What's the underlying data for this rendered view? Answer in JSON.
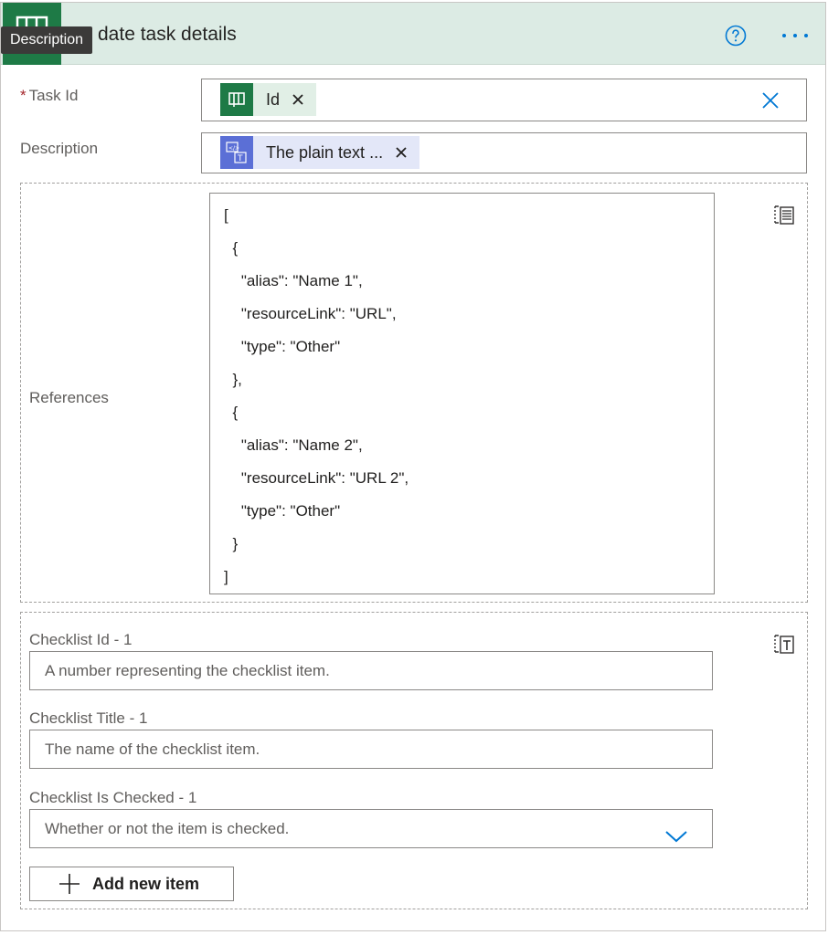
{
  "header": {
    "title": "date task details",
    "tooltip": "Description"
  },
  "fields": {
    "task_id": {
      "required_marker": "*",
      "label": "Task Id",
      "token_text": "Id"
    },
    "description": {
      "label": "Description",
      "token_text": "The plain text ..."
    },
    "references": {
      "label": "References",
      "json_lines": [
        "[",
        "  {",
        "    \"alias\": \"Name 1\",",
        "    \"resourceLink\": \"URL\",",
        "    \"type\": \"Other\"",
        "  },",
        "  {",
        "    \"alias\": \"Name 2\",",
        "    \"resourceLink\": \"URL 2\",",
        "    \"type\": \"Other\"",
        "  }",
        "]"
      ]
    },
    "checklist": {
      "id_label": "Checklist Id - 1",
      "id_placeholder": "A number representing the checklist item.",
      "title_label": "Checklist Title - 1",
      "title_placeholder": "The name of the checklist item.",
      "checked_label": "Checklist Is Checked - 1",
      "checked_placeholder": "Whether or not the item is checked.",
      "add_button": "Add new item"
    }
  },
  "icons": {
    "app": "planner-app-icon",
    "help": "help-circle-icon",
    "more": "more-dots-icon",
    "clear": "close-icon",
    "switch_array": "switch-to-array-icon",
    "switch_text": "switch-to-text-icon",
    "chevron": "chevron-down-icon",
    "add": "plus-icon"
  },
  "colors": {
    "header_bg": "#dcebe4",
    "app_green": "#1e7a46",
    "token_green_bg": "#e1efe6",
    "token_blue_bg": "#e3e7f8",
    "token_blue_icon": "#5b6fd6",
    "accent_blue": "#0078d4"
  }
}
